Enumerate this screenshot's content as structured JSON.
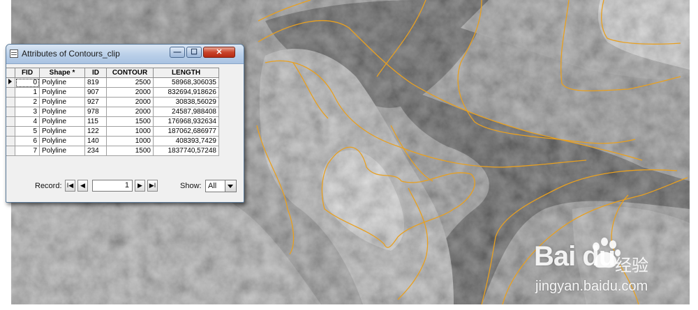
{
  "window": {
    "title": "Attributes of Contours_clip",
    "min_glyph": "—",
    "max_glyph": "☐",
    "close_glyph": "✕"
  },
  "table": {
    "headers": [
      "FID",
      "Shape *",
      "ID",
      "CONTOUR",
      "LENGTH"
    ],
    "rows": [
      {
        "fid": "0",
        "shape": "Polyline",
        "id": "819",
        "contour": "2500",
        "length": "58968,306035"
      },
      {
        "fid": "1",
        "shape": "Polyline",
        "id": "907",
        "contour": "2000",
        "length": "832694,918626"
      },
      {
        "fid": "2",
        "shape": "Polyline",
        "id": "927",
        "contour": "2000",
        "length": "30838,56029"
      },
      {
        "fid": "3",
        "shape": "Polyline",
        "id": "978",
        "contour": "2000",
        "length": "24587,988408"
      },
      {
        "fid": "4",
        "shape": "Polyline",
        "id": "115",
        "contour": "1500",
        "length": "176968,932634"
      },
      {
        "fid": "5",
        "shape": "Polyline",
        "id": "122",
        "contour": "1000",
        "length": "187062,686977"
      },
      {
        "fid": "6",
        "shape": "Polyline",
        "id": "140",
        "contour": "1000",
        "length": "408393,7429"
      },
      {
        "fid": "7",
        "shape": "Polyline",
        "id": "234",
        "contour": "1500",
        "length": "1837740,57248"
      }
    ]
  },
  "record_bar": {
    "record_label": "Record:",
    "record_value": "1",
    "first_glyph": "I◀",
    "prev_glyph": "◀",
    "next_glyph": "▶",
    "last_glyph": "▶I",
    "show_label": "Show:",
    "show_value": "All"
  },
  "watermark": {
    "brand": "Bai  du",
    "cn_text": "经验",
    "url": "jingyan.baidu.com"
  },
  "colors": {
    "contour_line": "#e8a020",
    "dialog_bg": "#f0f0f0",
    "close_button": "#c9442a"
  },
  "icons": {
    "window_icon": "table-icon",
    "watermark_logo": "paw-icon"
  }
}
